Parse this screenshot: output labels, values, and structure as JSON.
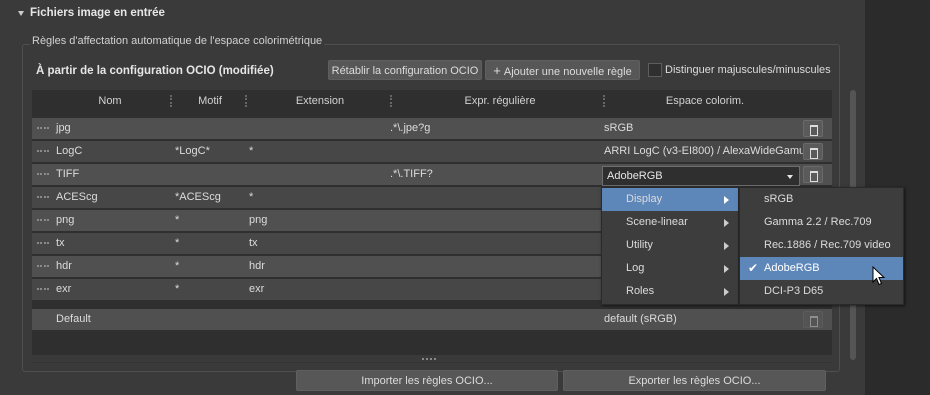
{
  "section": {
    "title": "Fichiers image en entrée"
  },
  "group": {
    "label": "Règles d'affectation automatique de l'espace colorimétrique"
  },
  "config": {
    "title": "À partir de la configuration OCIO (modifiée)",
    "reset_label": "Rétablir la configuration OCIO",
    "add_label": "Ajouter une nouvelle règle",
    "case_label": "Distinguer majuscules/minuscules"
  },
  "columns": [
    "Nom",
    "Motif",
    "Extension",
    "Expr. régulière",
    "Espace colorim."
  ],
  "rows": [
    {
      "name": "jpg",
      "pattern": "",
      "extension": "",
      "regex": ".*\\.jpe?g",
      "colorspace": "sRGB"
    },
    {
      "name": "LogC",
      "pattern": "*LogC*",
      "extension": "*",
      "regex": "",
      "colorspace": "ARRI LogC (v3-EI800) / AlexaWideGamu"
    },
    {
      "name": "TIFF",
      "pattern": "",
      "extension": "",
      "regex": ".*\\.TIFF?",
      "colorspace": "AdobeRGB"
    },
    {
      "name": "ACEScg",
      "pattern": "*ACEScg",
      "extension": "*",
      "regex": "",
      "colorspace": ""
    },
    {
      "name": "png",
      "pattern": "*",
      "extension": "png",
      "regex": "",
      "colorspace": ""
    },
    {
      "name": "tx",
      "pattern": "*",
      "extension": "tx",
      "regex": "",
      "colorspace": ""
    },
    {
      "name": "hdr",
      "pattern": "*",
      "extension": "hdr",
      "regex": "",
      "colorspace": ""
    },
    {
      "name": "exr",
      "pattern": "*",
      "extension": "exr",
      "regex": "",
      "colorspace": ""
    },
    {
      "name": "Default",
      "pattern": "",
      "extension": "",
      "regex": "",
      "colorspace": "default (sRGB)"
    }
  ],
  "dropdown": {
    "value": "AdobeRGB"
  },
  "menu_categories": [
    "Display",
    "Scene-linear",
    "Utility",
    "Log",
    "Roles"
  ],
  "menu_display_items": [
    "sRGB",
    "Gamma 2.2 / Rec.709",
    "Rec.1886 / Rec.709 video",
    "AdobeRGB",
    "DCI-P3 D65"
  ],
  "footer": {
    "import_label": "Importer les règles OCIO...",
    "export_label": "Exporter les règles OCIO..."
  },
  "colors": {
    "highlight": "#5d86b9",
    "panel": "#3a3a3a",
    "row_odd": "#505050",
    "row_even": "#474747"
  },
  "icons": [
    "collapse-triangle-icon",
    "plus-icon",
    "drag-handle-icon",
    "trash-icon",
    "chevron-down-icon",
    "submenu-arrow-icon",
    "checkmark-icon",
    "mouse-cursor-icon"
  ]
}
